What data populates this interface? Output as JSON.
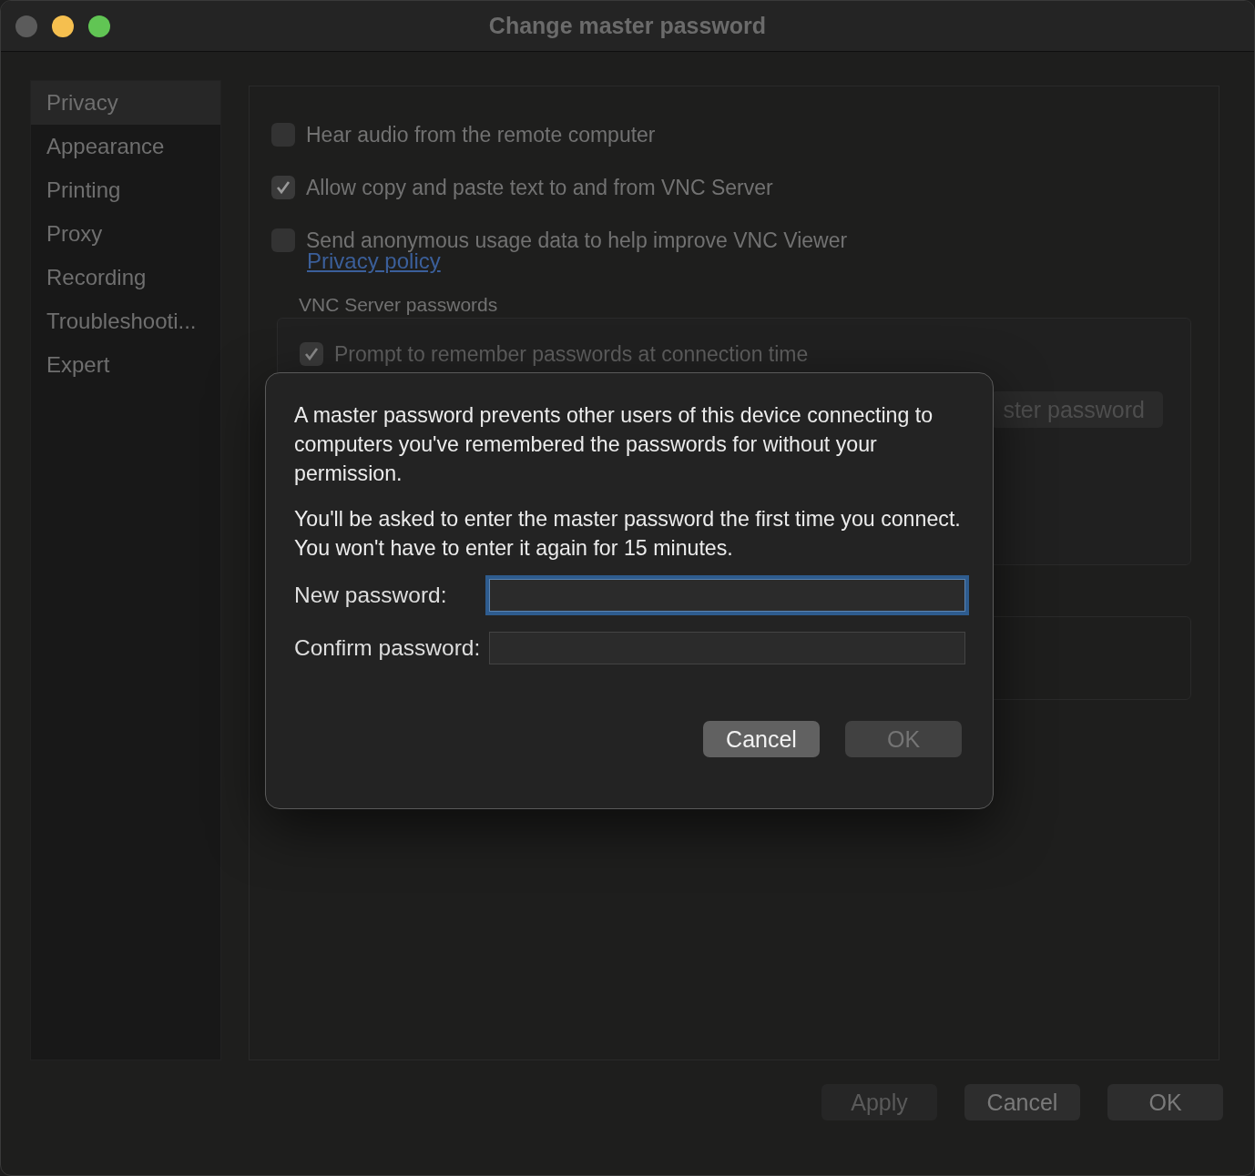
{
  "window": {
    "title": "Change master password"
  },
  "sidebar": {
    "items": [
      {
        "label": "Privacy",
        "selected": true
      },
      {
        "label": "Appearance",
        "selected": false
      },
      {
        "label": "Printing",
        "selected": false
      },
      {
        "label": "Proxy",
        "selected": false
      },
      {
        "label": "Recording",
        "selected": false
      },
      {
        "label": "Troubleshooti...",
        "selected": false
      },
      {
        "label": "Expert",
        "selected": false
      }
    ]
  },
  "options": [
    {
      "label": "Hear audio from the remote computer",
      "checked": false
    },
    {
      "label": "Allow copy and paste text to and from VNC Server",
      "checked": true
    },
    {
      "label": "Send anonymous usage data to help improve VNC Viewer",
      "checked": false
    }
  ],
  "privacy_link": "Privacy policy",
  "passwords_section": {
    "title": "VNC Server passwords",
    "prompt": {
      "label": "Prompt to remember passwords at connection time",
      "checked": true
    },
    "button": "ster password"
  },
  "dialog": {
    "paragraphs": [
      "A master password prevents other users of this device connecting to computers you've remembered the passwords for without your permission.",
      "You'll be asked to enter the master password the first time you connect. You won't have to enter it again for 15 minutes."
    ],
    "fields": [
      {
        "label": "New password:",
        "focused": true
      },
      {
        "label": "Confirm password:",
        "focused": false
      }
    ],
    "buttons": [
      {
        "label": "Cancel",
        "disabled": false
      },
      {
        "label": "OK",
        "disabled": true
      }
    ]
  },
  "buttons": [
    {
      "label": "Apply",
      "disabled": true
    },
    {
      "label": "Cancel",
      "disabled": false
    },
    {
      "label": "OK",
      "disabled": false
    }
  ]
}
